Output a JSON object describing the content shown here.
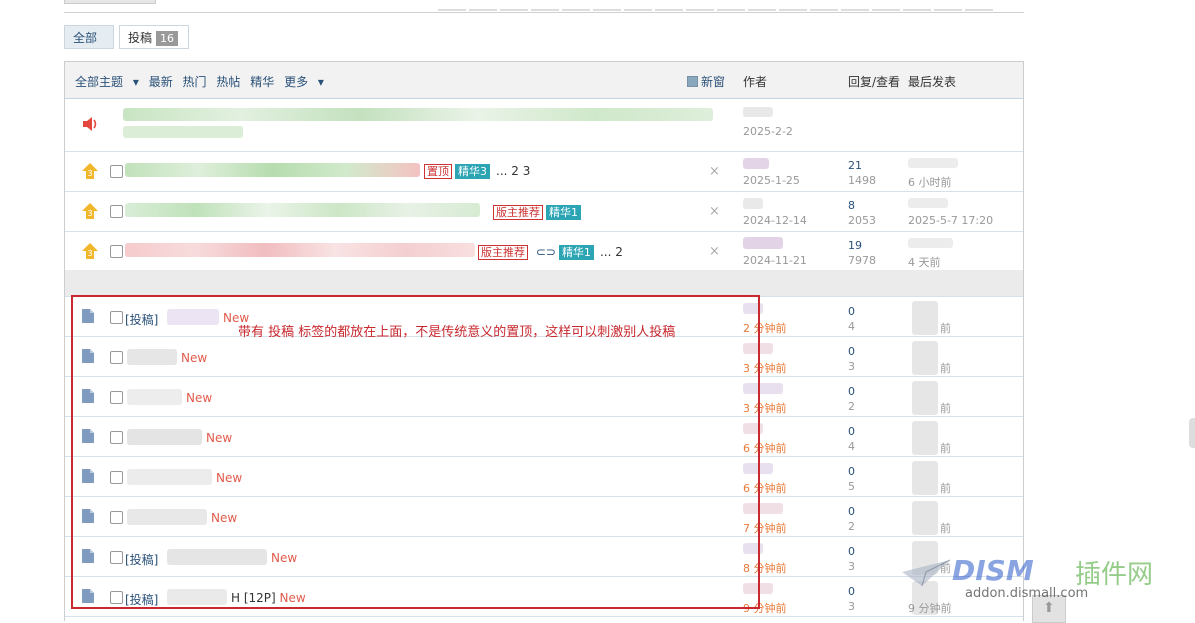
{
  "filter_tabs": {
    "all": "全部",
    "submissions": "投稿",
    "submissions_count": "16"
  },
  "table_header": {
    "all_topics": "全部主题",
    "latest": "最新",
    "hot": "热门",
    "hot_posts": "热帖",
    "digest": "精华",
    "more": "更多",
    "new_window": "新窗",
    "author": "作者",
    "reply_view": "回复/查看",
    "last_post": "最后发表"
  },
  "announcement": {
    "date": "2025-2-2"
  },
  "sticky_rows": [
    {
      "sticky_level": "3",
      "tag1": "置顶",
      "tag2": "精华3",
      "page_prefix": "...",
      "page1": "2",
      "page2": "3",
      "date": "2025-1-25",
      "replies": "21",
      "views": "1498",
      "last": "6 小时前"
    },
    {
      "sticky_level": "3",
      "tag1": "版主推荐",
      "tag2": "精华1",
      "date": "2024-12-14",
      "replies": "8",
      "views": "2053",
      "last": "2025-5-7 17:20"
    },
    {
      "sticky_level": "3",
      "tag1": "版主推荐",
      "tag2": "精华1",
      "page_prefix": "...",
      "page1": "2",
      "date": "2024-11-21",
      "replies": "19",
      "views": "7978",
      "last": "4 天前"
    }
  ],
  "normal_rows": [
    {
      "prefix": "[投稿]",
      "new": "New",
      "date": "2 分钟前",
      "replies": "0",
      "views": "4",
      "last": "前"
    },
    {
      "prefix": "",
      "new": "New",
      "date": "3 分钟前",
      "replies": "0",
      "views": "3",
      "last": "前"
    },
    {
      "prefix": "",
      "new": "New",
      "date": "3 分钟前",
      "replies": "0",
      "views": "2",
      "last": "前"
    },
    {
      "prefix": "",
      "new": "New",
      "date": "6 分钟前",
      "replies": "0",
      "views": "4",
      "last": "前"
    },
    {
      "prefix": "",
      "new": "New",
      "date": "6 分钟前",
      "replies": "0",
      "views": "5",
      "last": "前"
    },
    {
      "prefix": "",
      "new": "New",
      "date": "7 分钟前",
      "replies": "0",
      "views": "2",
      "last": "前"
    },
    {
      "prefix": "[投稿]",
      "new": "New",
      "date": "8 分钟前",
      "replies": "0",
      "views": "3",
      "last": "前"
    },
    {
      "prefix": "[投稿]",
      "suffix": "H [12P]",
      "new": "New",
      "date": "9 分钟前",
      "replies": "0",
      "views": "3",
      "last": "9 分钟前"
    }
  ],
  "annotation": "带有 投稿 标签的都放在上面，不是传统意义的置顶，这样可以刺激别人投稿",
  "watermark": {
    "brand": "DISM",
    "cn": "插件网",
    "url": "addon.dismall.com"
  },
  "colors": {
    "accent": "#2a5179",
    "annotation": "#c8282e",
    "tag_teal": "#2ba4b3",
    "new": "#e15b4c"
  }
}
